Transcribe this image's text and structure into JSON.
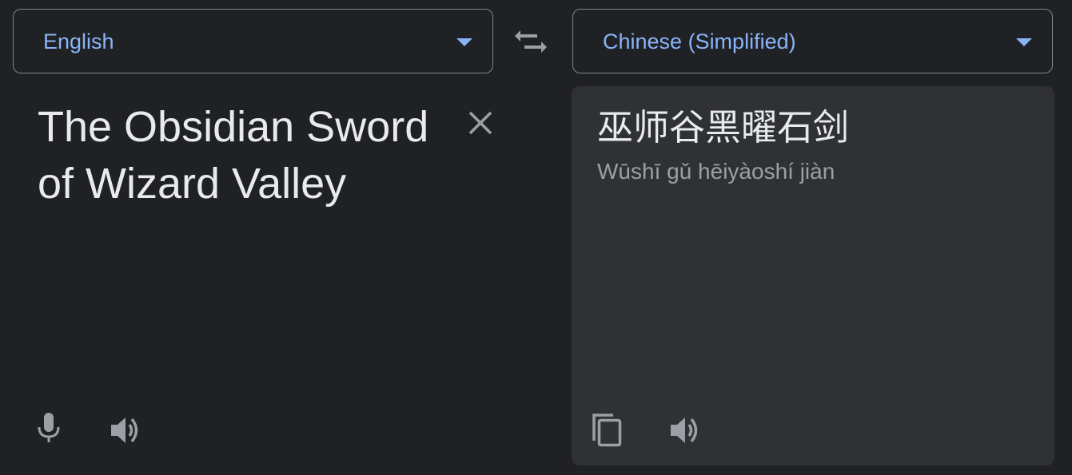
{
  "source": {
    "language": "English",
    "text": "The Obsidian Sword of Wizard Valley"
  },
  "target": {
    "language": "Chinese (Simplified)",
    "text": "巫师谷黑曜石剑",
    "romanization": "Wūshī gǔ hēiyàoshí jiàn"
  },
  "icons": {
    "swap": "swap-languages-icon",
    "clear": "close-icon",
    "mic": "microphone-icon",
    "speaker": "speaker-icon",
    "copy": "copy-icon"
  },
  "colors": {
    "background": "#202124",
    "panel": "#303134",
    "accent": "#8ab4f8",
    "text": "#e8eaed",
    "muted": "#9aa0a6",
    "border": "#80868b"
  }
}
